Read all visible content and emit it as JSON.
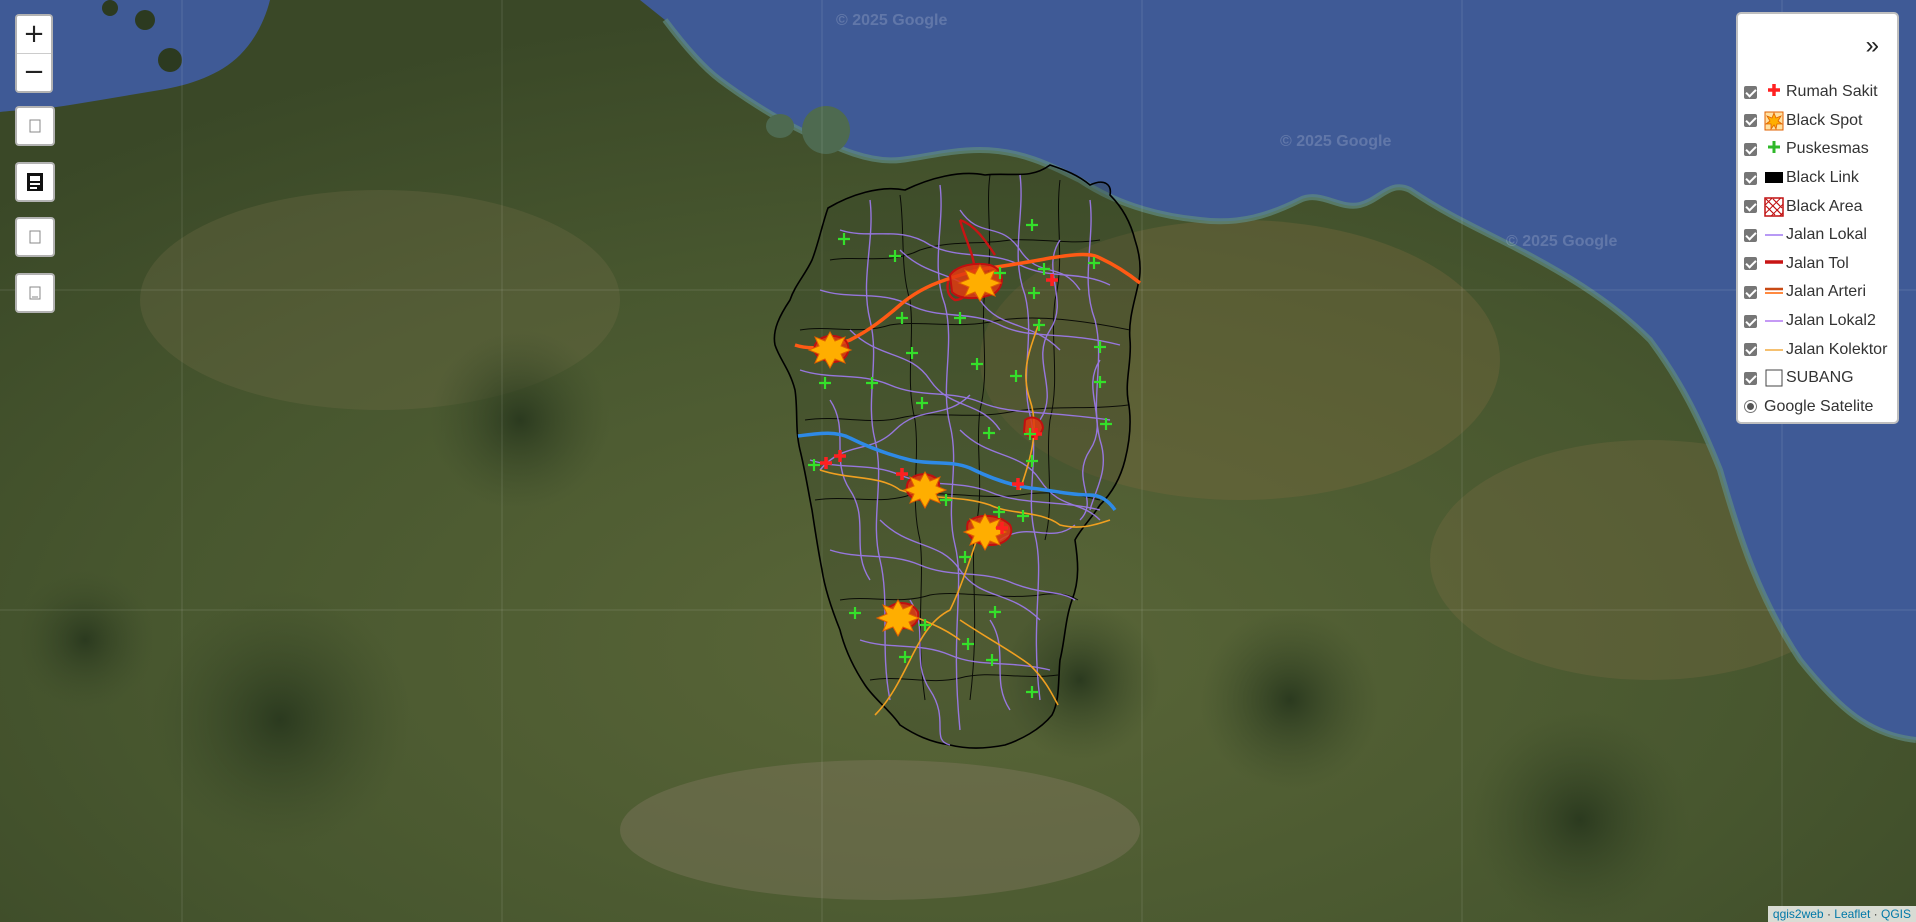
{
  "map": {
    "watermark": "© 2025 Google",
    "colors": {
      "sea": "#3f5a96",
      "land": "#4a5a32",
      "boundary": "#000000",
      "jalan_lokal": "#9f7bf0",
      "jalan_tol": "#c81414",
      "jalan_arteri": "#ff5a14",
      "jalan_kolektor": "#f0a020",
      "river": "#2e8ae6",
      "puskesmas": "#34e02a",
      "rumah_sakit": "#ff2020",
      "black_spot": "#ffae00"
    }
  },
  "controls": {
    "zoom_in_label": "+",
    "zoom_out_label": "−",
    "buttons": [
      {
        "icon": "layer-page-icon"
      },
      {
        "icon": "print-icon"
      },
      {
        "icon": "measure-icon"
      },
      {
        "icon": "locate-icon"
      }
    ]
  },
  "legend": {
    "toggle_label": "»",
    "items": [
      {
        "label": "Rumah Sakit",
        "symbol": "red-cross-icon",
        "checked": true
      },
      {
        "label": "Black Spot",
        "symbol": "star-burst-icon",
        "checked": true
      },
      {
        "label": "Puskesmas",
        "symbol": "green-cross-icon",
        "checked": true
      },
      {
        "label": "Black Link",
        "symbol": "black-rect-icon",
        "checked": true
      },
      {
        "label": "Black Area",
        "symbol": "hatched-area-icon",
        "checked": true
      },
      {
        "label": "Jalan Lokal",
        "symbol": "line-lokal-icon",
        "checked": true
      },
      {
        "label": "Jalan Tol",
        "symbol": "line-tol-icon",
        "checked": true
      },
      {
        "label": "Jalan Arteri",
        "symbol": "line-arteri-icon",
        "checked": true
      },
      {
        "label": "Jalan Lokal2",
        "symbol": "line-lokal2-icon",
        "checked": true
      },
      {
        "label": "Jalan Kolektor",
        "symbol": "line-kolektor-icon",
        "checked": true
      },
      {
        "label": "SUBANG",
        "symbol": "outline-rect-icon",
        "checked": true
      }
    ],
    "basemap": {
      "label": "Google Satelite",
      "selected": true
    }
  },
  "attribution": {
    "parts": [
      "qgis2web",
      "Leaflet",
      "QGIS"
    ],
    "separator": " · "
  }
}
